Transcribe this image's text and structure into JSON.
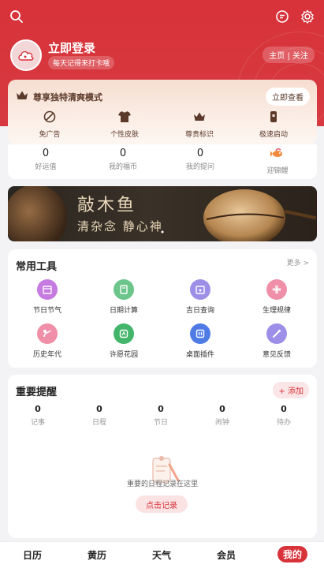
{
  "header": {
    "login_title": "立即登录",
    "login_subtitle": "每天记得来打卡哦",
    "home_follow": "主页 | 关注"
  },
  "vip": {
    "title": "尊享独特清爽模式",
    "cta": "立即查看",
    "features": [
      {
        "label": "免广告",
        "icon": "no-ads-icon"
      },
      {
        "label": "个性皮肤",
        "icon": "shirt-icon"
      },
      {
        "label": "尊贵标识",
        "icon": "crown-icon"
      },
      {
        "label": "极速启动",
        "icon": "rocket-icon"
      }
    ]
  },
  "stats": [
    {
      "value": "0",
      "label": "好运值"
    },
    {
      "value": "0",
      "label": "我的福币"
    },
    {
      "value": "0",
      "label": "我的提问"
    },
    {
      "value": "",
      "label": "迎锦鲤"
    }
  ],
  "banner": {
    "title": "敲木鱼",
    "subtitle": "清杂念 静心神"
  },
  "tools": {
    "title": "常用工具",
    "more": "更多 >",
    "items": [
      {
        "label": "节日节气",
        "color": "#c57be0",
        "icon": "calendar-icon"
      },
      {
        "label": "日期计算",
        "color": "#6cc58a",
        "icon": "calculator-icon"
      },
      {
        "label": "吉日查询",
        "color": "#9d8ee8",
        "icon": "search-calendar-icon"
      },
      {
        "label": "生理规律",
        "color": "#ef8fa8",
        "icon": "flower-icon"
      },
      {
        "label": "历史年代",
        "color": "#ef8fa8",
        "icon": "history-icon"
      },
      {
        "label": "许愿花园",
        "color": "#43b56a",
        "icon": "garden-icon"
      },
      {
        "label": "桌面插件",
        "color": "#4f7be6",
        "icon": "widget-icon"
      },
      {
        "label": "意见反馈",
        "color": "#9d8ee8",
        "icon": "feedback-icon"
      }
    ]
  },
  "reminders": {
    "title": "重要提醒",
    "add": "+ 添加",
    "items": [
      {
        "value": "0",
        "label": "记事"
      },
      {
        "value": "0",
        "label": "日程"
      },
      {
        "value": "0",
        "label": "节日"
      },
      {
        "value": "0",
        "label": "闹钟"
      },
      {
        "value": "0",
        "label": "待办"
      }
    ],
    "empty_text": "重要的日程记录在这里",
    "record_button": "点击记录"
  },
  "nav": {
    "items": [
      {
        "label": "日历"
      },
      {
        "label": "黄历"
      },
      {
        "label": "天气"
      },
      {
        "label": "会员"
      },
      {
        "label": "我的"
      }
    ],
    "active_index": 4
  },
  "colors": {
    "brand_red": "#d8323a"
  }
}
